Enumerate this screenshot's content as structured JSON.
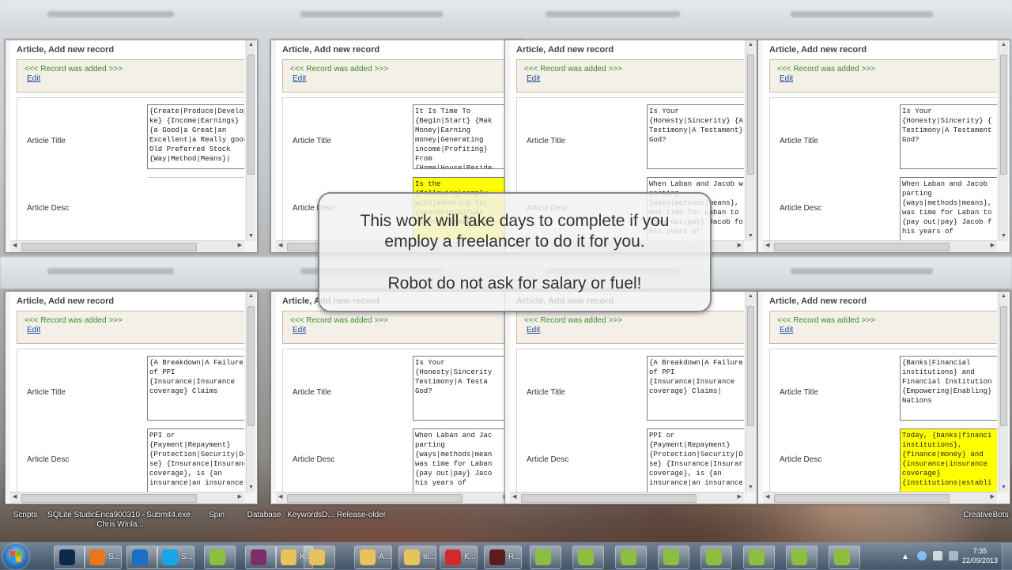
{
  "windows": [
    {
      "title": "Article, Add new record",
      "notice": "<<< Record was added >>>",
      "edit": "Edit",
      "title_label": "Article Title",
      "desc_label": "Article Desc",
      "title_text": "{Create|Produce|Develop|Ma\nke} {Income|Earnings} In\n{a Good|a Great|an\nExcellent|a Really good}\nOld Preferred Stock\n{Way|Method|Means}|",
      "desc_text": "",
      "desc_yellow": false
    },
    {
      "title": "Article, Add new record",
      "notice": "<<< Record was added >>>",
      "edit": "Edit",
      "title_label": "Article Title",
      "desc_label": "Article Desc",
      "title_text": "It Is Time To\n{Begin|Start} {Mak\nMoney|Earning\nmoney|Generating\nincome|Profiting}\nFrom\n{Home|House|Reside",
      "desc_text": "Is the\n{following|comply\nwith|adhering to|\n{Scenario|Situat\nstance} something",
      "desc_yellow": true
    },
    {
      "title": "Article, Add new record",
      "notice": "<<< Record was added >>>",
      "edit": "Edit",
      "title_label": "Article Title",
      "desc_label": "Article Desc",
      "title_text": "Is Your\n{Honesty|Sincerity} {A\nTestimony|A Testament}\nGod?",
      "desc_text": "When Laban and Jacob w\nparting\n{ways|methods|means},\nwas time for Laban to\n{pay out|pay} Jacob fo\nhis years of",
      "desc_yellow": false
    },
    {
      "title": "Article, Add new record",
      "notice": "<<< Record was added >>>",
      "edit": "Edit",
      "title_label": "Article Title",
      "desc_label": "Article Desc",
      "title_text": "Is Your\n{Honesty|Sincerity} {\nTestimony|A Testament\nGod?",
      "desc_text": "When Laban and Jacob\nparting\n{ways|methods|means},\nwas time for Laban to\n{pay out|pay} Jacob f\nhis years of",
      "desc_yellow": false
    },
    {
      "title": "Article, Add new record",
      "notice": "<<< Record was added >>>",
      "edit": "Edit",
      "title_label": "Article Title",
      "desc_label": "Article Desc",
      "title_text": "{A Breakdown|A Failure}\nof PPI\n{Insurance|Insurance\ncoverage} Claims",
      "desc_text": "PPI or\n{Payment|Repayment}\n{Protection|Security|Defe\nse} {Insurance|Insurance\ncoverage}, is {an\ninsurance|an insurance",
      "desc_yellow": false
    },
    {
      "title": "Article, Add new record",
      "notice": "<<< Record was added >>>",
      "edit": "Edit",
      "title_label": "Article Title",
      "desc_label": "Article Desc",
      "title_text": "Is Your\n{Honesty|Sincerity\nTestimony|A Testa\nGod?",
      "desc_text": "When Laban and Jac\nparting\n{ways|methods|mean\nwas time for Laban\n{pay out|pay} Jaco\nhis years of",
      "desc_yellow": false
    },
    {
      "title": "Article, Add new record",
      "notice": "<<< Record was added >>>",
      "edit": "Edit",
      "title_label": "Article Title",
      "desc_label": "Article Desc",
      "title_text": "{A Breakdown|A Failure\nof PPI\n{Insurance|Insurance\ncoverage} Claims|",
      "desc_text": "PPI or\n{Payment|Repayment}\n{Protection|Security|D\nse} {Insurance|Insurar\ncoverage}, is {an\ninsurance|an insurance",
      "desc_yellow": false
    },
    {
      "title": "Article, Add new record",
      "notice": "<<< Record was added >>>",
      "edit": "Edit",
      "title_label": "Article Title",
      "desc_label": "Article Desc",
      "title_text": "{Banks|Financial\ninstitutions} and\nFinancial Institution\n{Empowering|Enabling}\nNations",
      "desc_text": "Today, {banks|financi\ninstitutions},\n{finance|money} and\n{insurance|insurance\ncoverage}\n{institutions|establi",
      "desc_yellow": true
    }
  ],
  "overlay": {
    "line1": "This work will take days to complete if you",
    "line2": "employ a freelancer to do it for you.",
    "line3": "Robot do not ask for salary or fuel!"
  },
  "desktop_icons": [
    {
      "label": "Scripts"
    },
    {
      "label": "SQLite Studio"
    },
    {
      "label": "Erica900310 -\nChris Winla..."
    },
    {
      "label": "Submit4.exe"
    },
    {
      "label": "Spin"
    },
    {
      "label": "Database"
    },
    {
      "label": "KeywordsD..."
    },
    {
      "label": "Release-older"
    },
    {
      "label": "CreativeBots"
    }
  ],
  "taskbar": {
    "items": [
      {
        "icon": "photoshop-icon",
        "label": ""
      },
      {
        "icon": "firefox-icon",
        "label": "S..."
      },
      {
        "icon": "teamviewer-icon",
        "label": ""
      },
      {
        "icon": "skype-icon",
        "label": "S..."
      },
      {
        "icon": "robot-icon",
        "label": ""
      },
      {
        "icon": "winrar-icon",
        "label": ""
      },
      {
        "icon": "folder-icon",
        "label": "K..."
      },
      {
        "icon": "folder-icon",
        "label": ""
      },
      {
        "icon": "folder-icon",
        "label": "A..."
      },
      {
        "icon": "folder-icon",
        "label": "te..."
      },
      {
        "icon": "car-icon",
        "label": "K..."
      },
      {
        "icon": "camera-icon",
        "label": "R..."
      },
      {
        "icon": "robot-icon",
        "label": ""
      },
      {
        "icon": "robot-icon",
        "label": ""
      },
      {
        "icon": "robot-icon",
        "label": ""
      },
      {
        "icon": "robot-icon",
        "label": ""
      },
      {
        "icon": "robot-icon",
        "label": ""
      },
      {
        "icon": "robot-icon",
        "label": ""
      },
      {
        "icon": "robot-icon",
        "label": ""
      },
      {
        "icon": "robot-icon",
        "label": ""
      }
    ],
    "time": "7:35",
    "date": "22/09/2013"
  }
}
